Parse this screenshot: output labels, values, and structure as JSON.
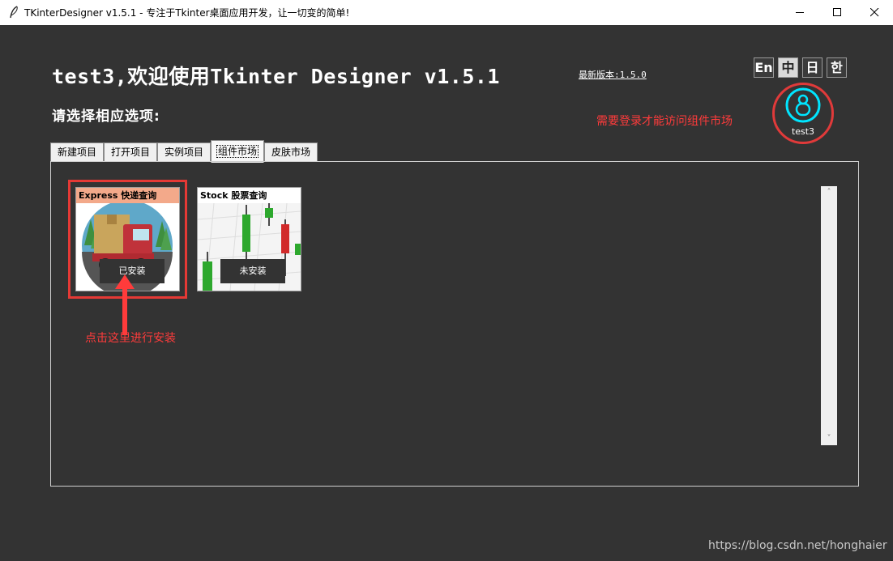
{
  "window": {
    "title": "TKinterDesigner v1.5.1 - 专注于Tkinter桌面应用开发，让一切变的简单!"
  },
  "header": {
    "welcome": "test3,欢迎使用Tkinter Designer v1.5.1",
    "latest_version": "最新版本:1.5.0",
    "prompt": "请选择相应选项:"
  },
  "languages": [
    {
      "label": "En",
      "active": false
    },
    {
      "label": "中",
      "active": true
    },
    {
      "label": "日",
      "active": false
    },
    {
      "label": "한",
      "active": false
    }
  ],
  "user": {
    "name": "test3",
    "login_hint": "需要登录才能访问组件市场"
  },
  "tabs": [
    {
      "label": "新建项目"
    },
    {
      "label": "打开项目"
    },
    {
      "label": "实例项目"
    },
    {
      "label": "组件市场",
      "active": true
    },
    {
      "label": "皮肤市场"
    }
  ],
  "components": [
    {
      "title": "Express 快递查询",
      "status": "已安装"
    },
    {
      "title": "Stock 股票查询",
      "status": "未安装"
    }
  ],
  "annotations": {
    "install_hint": "点击这里进行安装"
  },
  "watermark": "https://blog.csdn.net/honghaier",
  "colors": {
    "background": "#333333",
    "highlight": "#e53935",
    "annotation": "#ff3b3b",
    "avatar": "#00e5ff"
  }
}
